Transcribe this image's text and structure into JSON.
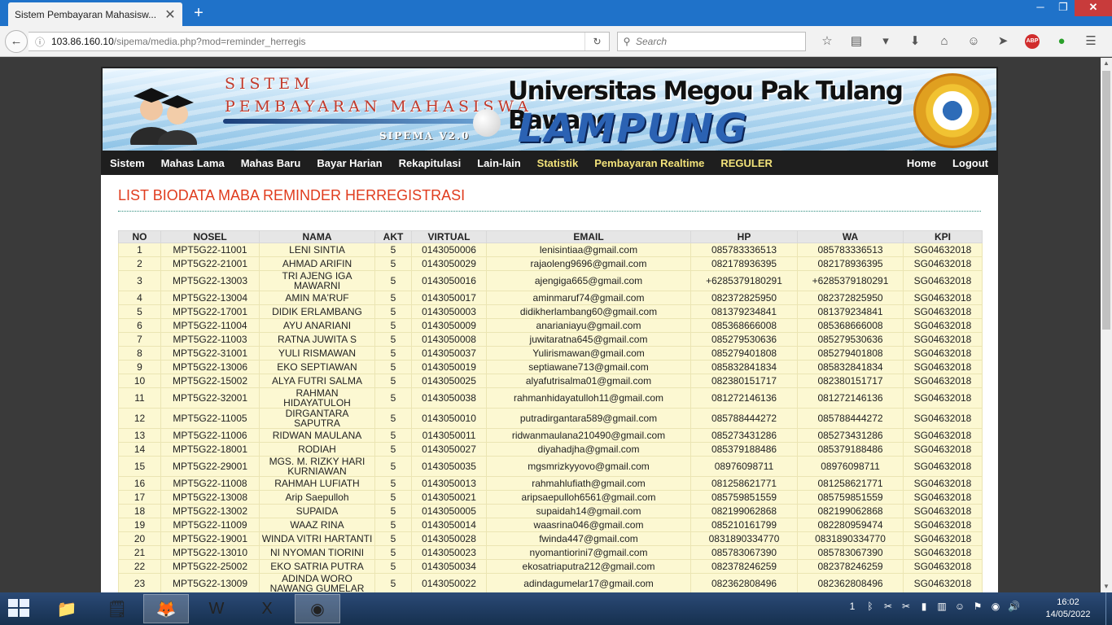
{
  "browser": {
    "tab_title": "Sistem Pembayaran Mahasisw...",
    "url_host": "103.86.160.10",
    "url_path": "/sipema/media.php?mod=reminder_herregis",
    "search_placeholder": "Search"
  },
  "banner": {
    "line1": "SISTEM",
    "line2": "PEMBAYARAN MAHASISWA",
    "version": "SIPEMA V2.0",
    "university": "Universitas Megou Pak Tulang Bawang",
    "city": "LAMPUNG"
  },
  "menu": {
    "left": [
      {
        "label": "Sistem",
        "highlight": false
      },
      {
        "label": "Mahas Lama",
        "highlight": false
      },
      {
        "label": "Mahas Baru",
        "highlight": false
      },
      {
        "label": "Bayar Harian",
        "highlight": false
      },
      {
        "label": "Rekapitulasi",
        "highlight": false
      },
      {
        "label": "Lain-lain",
        "highlight": false
      },
      {
        "label": "Statistik",
        "highlight": true
      },
      {
        "label": "Pembayaran Realtime",
        "highlight": true
      },
      {
        "label": "REGULER",
        "highlight": true
      }
    ],
    "right": [
      {
        "label": "Home"
      },
      {
        "label": "Logout"
      }
    ]
  },
  "page_title": "LIST BIODATA MABA REMINDER HERREGISTRASI",
  "table": {
    "columns": [
      "NO",
      "NOSEL",
      "NAMA",
      "AKT",
      "VIRTUAL",
      "EMAIL",
      "HP",
      "WA",
      "KPI"
    ],
    "rows": [
      [
        "1",
        "MPT5G22-11001",
        "LENI SINTIA",
        "5",
        "0143050006",
        "lenisintiaa@gmail.com",
        "085783336513",
        "085783336513",
        "SG04632018"
      ],
      [
        "2",
        "MPT5G22-21001",
        "AHMAD ARIFIN",
        "5",
        "0143050029",
        "rajaoleng9696@gmail.com",
        "082178936395",
        "082178936395",
        "SG04632018"
      ],
      [
        "3",
        "MPT5G22-13003",
        "TRI AJENG IGA MAWARNI",
        "5",
        "0143050016",
        "ajengiga665@gmail.com",
        "+6285379180291",
        "+6285379180291",
        "SG04632018"
      ],
      [
        "4",
        "MPT5G22-13004",
        "AMIN MA'RUF",
        "5",
        "0143050017",
        "aminmaruf74@gmail.com",
        "082372825950",
        "082372825950",
        "SG04632018"
      ],
      [
        "5",
        "MPT5G22-17001",
        "DIDIK ERLAMBANG",
        "5",
        "0143050003",
        "didikherlambang60@gmail.com",
        "081379234841",
        "081379234841",
        "SG04632018"
      ],
      [
        "6",
        "MPT5G22-11004",
        "AYU ANARIANI",
        "5",
        "0143050009",
        "anarianiayu@gmail.com",
        "085368666008",
        "085368666008",
        "SG04632018"
      ],
      [
        "7",
        "MPT5G22-11003",
        "RATNA JUWITA S",
        "5",
        "0143050008",
        "juwitaratna645@gmail.com",
        "085279530636",
        "085279530636",
        "SG04632018"
      ],
      [
        "8",
        "MPT5G22-31001",
        "YULI RISMAWAN",
        "5",
        "0143050037",
        "Yulirismawan@gmail.com",
        "085279401808",
        "085279401808",
        "SG04632018"
      ],
      [
        "9",
        "MPT5G22-13006",
        "EKO SEPTIAWAN",
        "5",
        "0143050019",
        "septiawane713@gmail.com",
        "085832841834",
        "085832841834",
        "SG04632018"
      ],
      [
        "10",
        "MPT5G22-15002",
        "ALYA FUTRI SALMA",
        "5",
        "0143050025",
        "alyafutrisalma01@gmail.com",
        "082380151717",
        "082380151717",
        "SG04632018"
      ],
      [
        "11",
        "MPT5G22-32001",
        "RAHMAN HIDAYATULOH",
        "5",
        "0143050038",
        "rahmanhidayatulloh11@gmail.com",
        "081272146136",
        "081272146136",
        "SG04632018"
      ],
      [
        "12",
        "MPT5G22-11005",
        "DIRGANTARA SAPUTRA",
        "5",
        "0143050010",
        "putradirgantara589@gmail.com",
        "085788444272",
        "085788444272",
        "SG04632018"
      ],
      [
        "13",
        "MPT5G22-11006",
        "RIDWAN MAULANA",
        "5",
        "0143050011",
        "ridwanmaulana210490@gmail.com",
        "085273431286",
        "085273431286",
        "SG04632018"
      ],
      [
        "14",
        "MPT5G22-18001",
        "RODIAH",
        "5",
        "0143050027",
        "diyahadjha@gmail.com",
        "085379188486",
        "085379188486",
        "SG04632018"
      ],
      [
        "15",
        "MPT5G22-29001",
        "MGS. M. RIZKY HARI KURNIAWAN",
        "5",
        "0143050035",
        "mgsmrizkyyovo@gmail.com",
        "08976098711",
        "08976098711",
        "SG04632018"
      ],
      [
        "16",
        "MPT5G22-11008",
        "RAHMAH LUFIATH",
        "5",
        "0143050013",
        "rahmahlufiath@gmail.com",
        "081258621771",
        "081258621771",
        "SG04632018"
      ],
      [
        "17",
        "MPT5G22-13008",
        "Arip Saepulloh",
        "5",
        "0143050021",
        "aripsaepulloh6561@gmail.com",
        "085759851559",
        "085759851559",
        "SG04632018"
      ],
      [
        "18",
        "MPT5G22-13002",
        "SUPAIDA",
        "5",
        "0143050005",
        "supaidah14@gmail.com",
        "082199062868",
        "082199062868",
        "SG04632018"
      ],
      [
        "19",
        "MPT5G22-11009",
        "WAAZ RINA",
        "5",
        "0143050014",
        "waasrina046@gmail.com",
        "085210161799",
        "082280959474",
        "SG04632018"
      ],
      [
        "20",
        "MPT5G22-19001",
        "WINDA VITRI HARTANTI",
        "5",
        "0143050028",
        "fwinda447@gmail.com",
        "0831890334770",
        "0831890334770",
        "SG04632018"
      ],
      [
        "21",
        "MPT5G22-13010",
        "NI NYOMAN TIORINI",
        "5",
        "0143050023",
        "nyomantiorini7@gmail.com",
        "085783067390",
        "085783067390",
        "SG04632018"
      ],
      [
        "22",
        "MPT5G22-25002",
        "EKO SATRIA PUTRA",
        "5",
        "0143050034",
        "ekosatriaputra212@gmail.com",
        "082378246259",
        "082378246259",
        "SG04632018"
      ],
      [
        "23",
        "MPT5G22-13009",
        "ADINDA WORO NAWANG GUMELAR",
        "5",
        "0143050022",
        "adindagumelar17@gmail.com",
        "082362808496",
        "082362808496",
        "SG04632018"
      ]
    ]
  },
  "taskbar": {
    "time": "16:02",
    "date": "14/05/2022",
    "notify_count": "1"
  },
  "icons": {
    "back": "back-arrow-icon",
    "info": "info-icon",
    "reload": "reload-icon",
    "search": "search-icon",
    "bookmark": "star-icon",
    "reader": "reading-list-icon",
    "pocket": "pocket-icon",
    "download": "download-icon",
    "home": "home-icon",
    "emoji": "emoji-icon",
    "send": "send-icon",
    "adblock": "adblock-icon",
    "hamburger": "menu-icon"
  }
}
